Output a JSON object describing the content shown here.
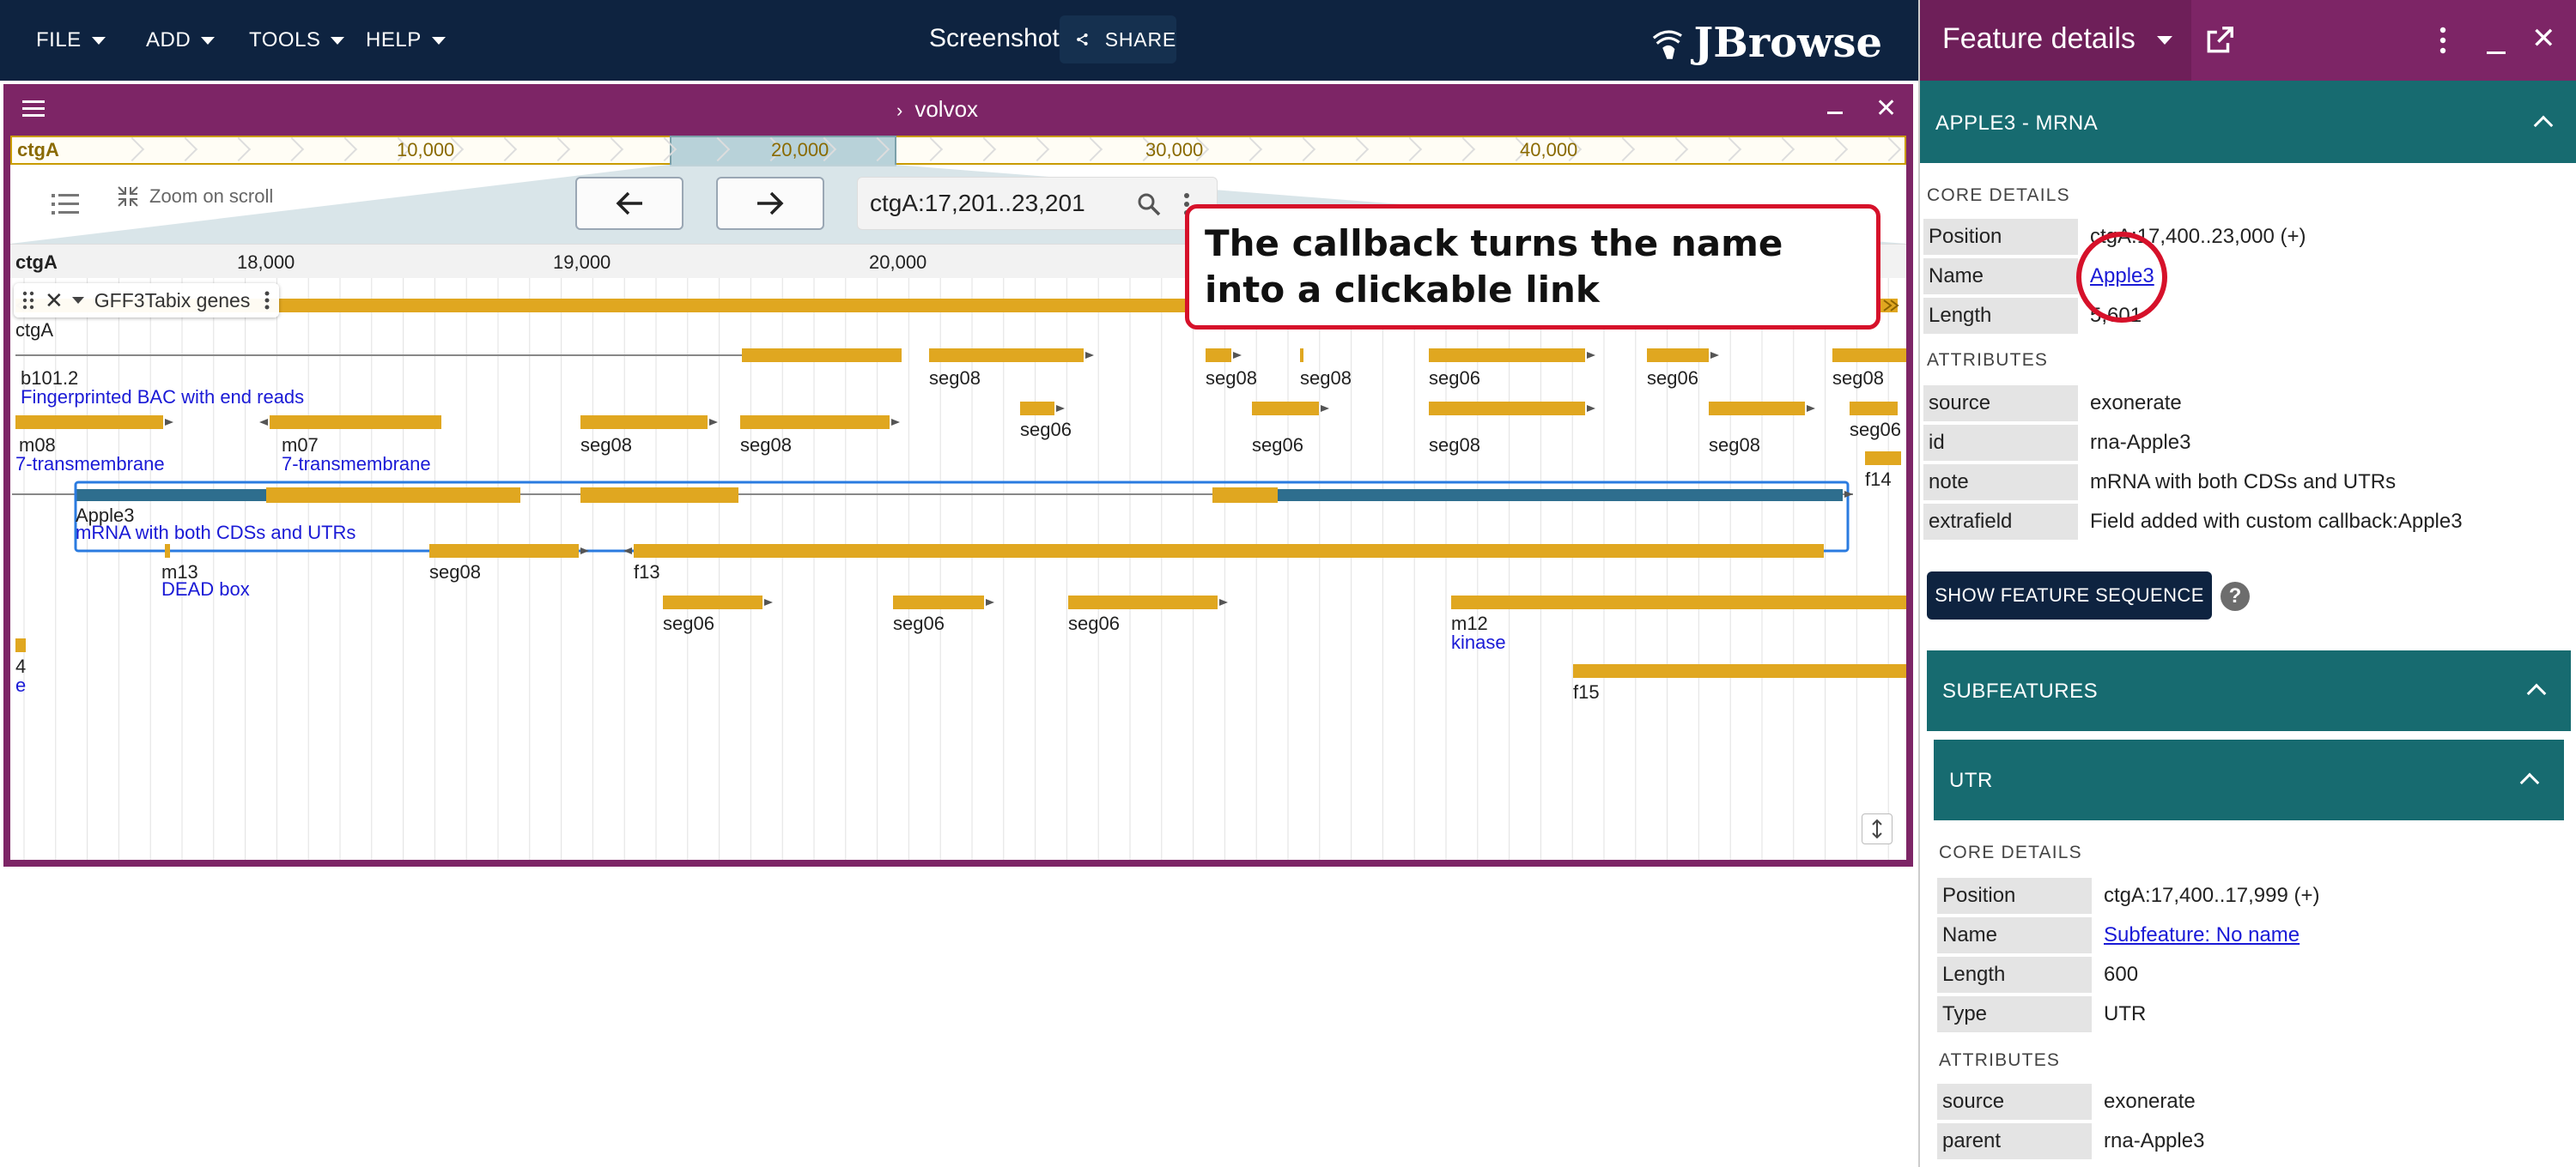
{
  "menubar": {
    "file": "FILE",
    "add": "ADD",
    "tools": "TOOLS",
    "help": "HELP",
    "session_name": "Screenshot",
    "share_label": "SHARE",
    "logo_text": "JBrowse"
  },
  "view": {
    "title": "volvox",
    "overview": {
      "contig": "ctgA",
      "ticks": [
        "10,000",
        "20,000",
        "30,000",
        "40,000"
      ]
    },
    "zoom_label": "Zoom on scroll",
    "location_value": "ctgA:17,201..23,201",
    "ruler": {
      "contig": "ctgA",
      "ticks": [
        "18,000",
        "19,000",
        "20,000"
      ]
    },
    "track_name": "GFF3Tabix genes"
  },
  "features": [
    {
      "name": "ctgA",
      "desc": ""
    },
    {
      "name": "b101.2",
      "desc": "Fingerprinted BAC with end reads"
    },
    {
      "name": "m08",
      "desc": "7-transmembrane"
    },
    {
      "name": "m07",
      "desc": "7-transmembrane"
    },
    {
      "name": "Apple3",
      "desc": "mRNA with both CDSs and UTRs"
    },
    {
      "name": "m13",
      "desc": "DEAD box"
    },
    {
      "name": "f13",
      "desc": ""
    },
    {
      "name": "m12",
      "desc": "kinase"
    },
    {
      "name": "f15",
      "desc": ""
    },
    {
      "name": "f14",
      "desc": ""
    },
    {
      "name": "4",
      "desc": "e"
    }
  ],
  "segment_labels": {
    "seg08": "seg08",
    "seg06": "seg06"
  },
  "callout_text": "The callback turns the name into a clickable link",
  "drawer": {
    "title": "Feature details",
    "feature_header": "APPLE3 - MRNA",
    "core_details_title": "CORE DETAILS",
    "core_details": [
      {
        "key": "Position",
        "value": "ctgA:17,400..23,000 (+)"
      },
      {
        "key": "Name",
        "value": "Apple3"
      },
      {
        "key": "Length",
        "value": "5,601"
      }
    ],
    "attributes_title": "ATTRIBUTES",
    "attributes": [
      {
        "key": "source",
        "value": "exonerate"
      },
      {
        "key": "id",
        "value": "rna-Apple3"
      },
      {
        "key": "note",
        "value": "mRNA with both CDSs and UTRs"
      },
      {
        "key": "extrafield",
        "value": "Field added with custom callback:Apple3"
      }
    ],
    "show_sequence_label": "SHOW FEATURE SEQUENCE",
    "subfeatures_header": "SUBFEATURES",
    "utr": {
      "header": "UTR",
      "core_details_title": "CORE DETAILS",
      "core_details": [
        {
          "key": "Position",
          "value": "ctgA:17,400..17,999 (+)"
        },
        {
          "key": "Name",
          "value": "Subfeature: No name"
        },
        {
          "key": "Length",
          "value": "600"
        },
        {
          "key": "Type",
          "value": "UTR"
        }
      ],
      "attributes_title": "ATTRIBUTES",
      "attributes": [
        {
          "key": "source",
          "value": "exonerate"
        },
        {
          "key": "parent",
          "value": "rna-Apple3"
        }
      ]
    }
  },
  "colors": {
    "appbar": "#0e2340",
    "view_header": "#7d2566",
    "feature": "#e0a720",
    "selected_feature": "#2e6e8e",
    "accordion": "#176b70",
    "link": "#1a1ad6",
    "highlight": "#d6112a"
  }
}
